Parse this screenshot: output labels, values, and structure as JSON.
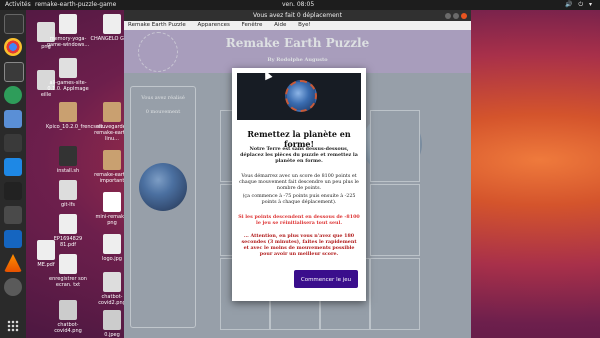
{
  "topbar": {
    "activities": "Activités",
    "app": "remake-earth-puzzle-game",
    "clock": "ven. 08:05",
    "system": "🔊 ⏻ ▾"
  },
  "desktop": {
    "col1": [
      "png",
      "eille",
      "ME.pdf",
      "EP1694829 81.pdf"
    ],
    "col2": [
      "memory-yoga-game-windows...",
      "all-games-site-0.1.0. AppImage",
      "Kpico_10.2.0_frencsoft...",
      "install.sh",
      "git-lfs",
      "EP1694829 81.pdf",
      "enregistrer son ecran. txt",
      "chatbot-covid4.png"
    ],
    "col3": [
      "CHANGELO G.md",
      "sauvegarde-remake-earth-linu...",
      "remake-earth-important",
      "mini-remake. png",
      "logo.jpg",
      "chatbot-covid2.png",
      "0.jpeg"
    ]
  },
  "window": {
    "title": "Vous avez fait 0 déplacement",
    "menu": [
      "Remake Earth Puzzle",
      "Apparences",
      "Fenêtre",
      "Aide",
      "Bye!"
    ]
  },
  "page": {
    "title": "Remake Earth Puzzle",
    "subtitle": "By Rodolphe Augusto",
    "stats_line1": "Vous avez réalisé",
    "stats_line2": "0 mouvement"
  },
  "modal": {
    "title": "Remettez la planète en forme!",
    "para1": "Notre Terre est sans dessus-dessous, déplacez les pièces du puzzle et remettez la planète en forme.",
    "para2": "Vous démarrez avec un score de 8100 points et chaque mouvement fait descendre un peu plus le nombre de points.",
    "para3": "(ça commence à -75 points puis ensuite à -225 points à chaque déplacement).",
    "warn1": "Si les points descendent en dessous de -8100 le jeu se réinitialisera tout seul.",
    "warn2": "... Attention, en plus vous n'avez que 180 secondes (3 minutes), faites le rapidement et avec le moins de mouvements possible pour avoir un meilleur score.",
    "button": "Commencer le jeu"
  },
  "colors": {
    "accent": "#3a0e8c",
    "header": "#b8a6cc",
    "warning": "#d33333"
  }
}
